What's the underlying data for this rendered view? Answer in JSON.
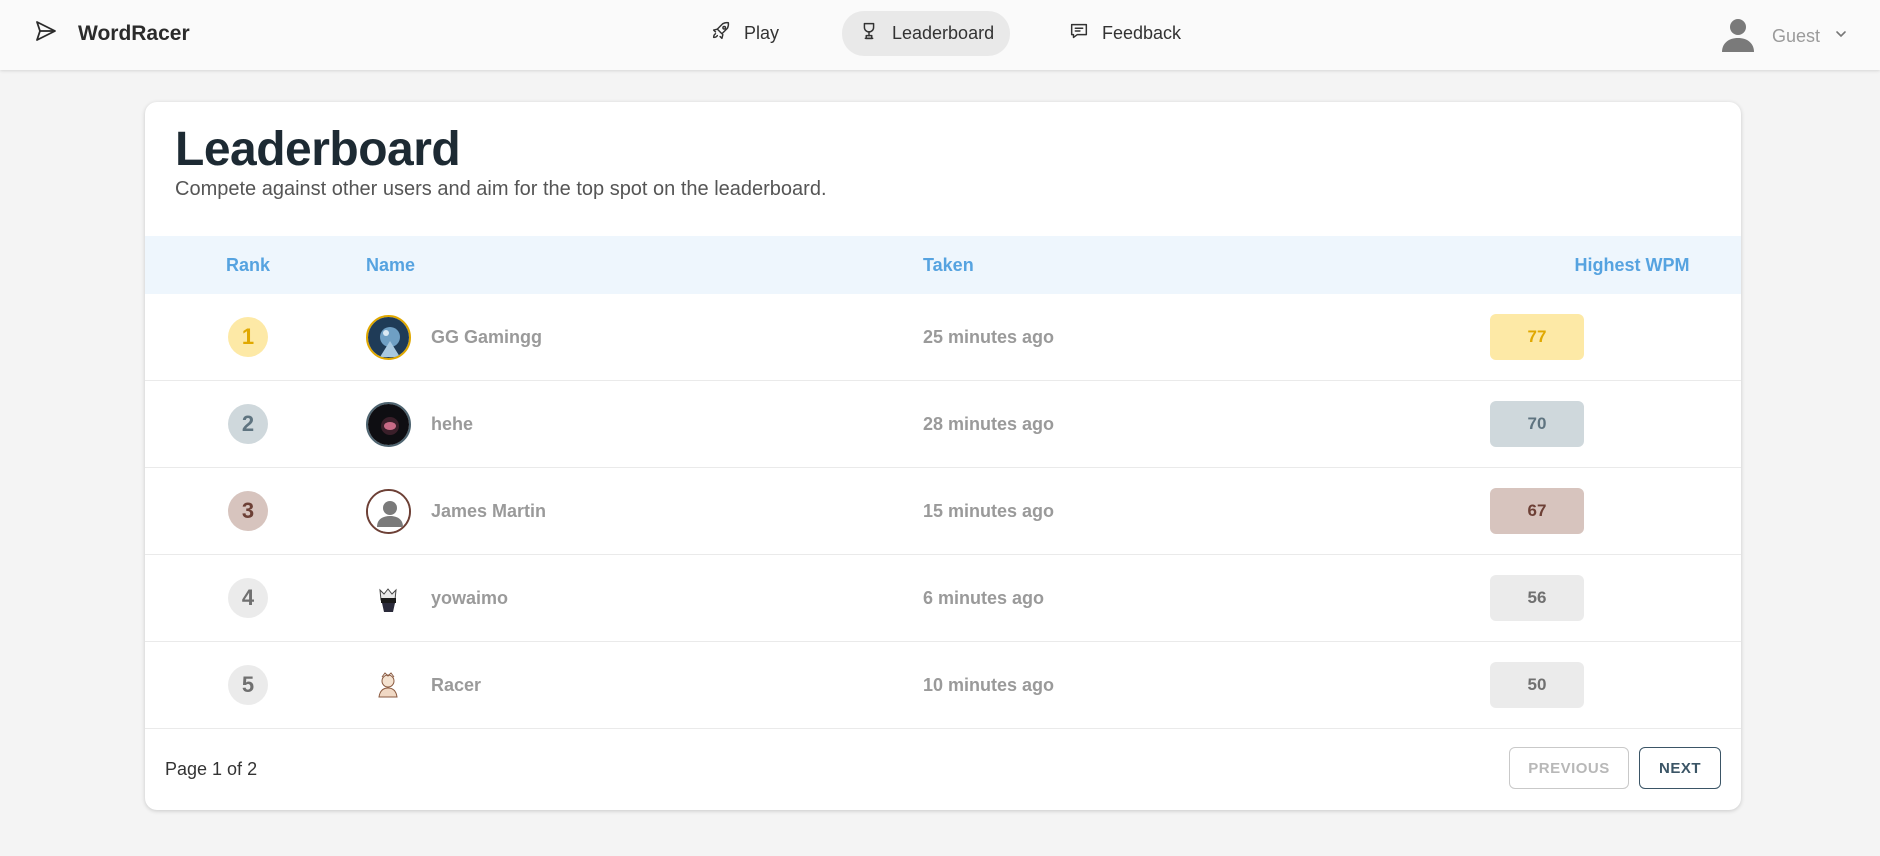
{
  "app": {
    "name": "WordRacer"
  },
  "nav": {
    "play": "Play",
    "leaderboard": "Leaderboard",
    "feedback": "Feedback"
  },
  "user": {
    "name": "Guest"
  },
  "page": {
    "title": "Leaderboard",
    "subtitle": "Compete against other users and aim for the top spot on the leaderboard."
  },
  "table": {
    "headers": {
      "rank": "Rank",
      "name": "Name",
      "taken": "Taken",
      "wpm": "Highest WPM"
    },
    "rows": [
      {
        "rank": "1",
        "name": "GG Gamingg",
        "taken": "25 minutes ago",
        "wpm": "77",
        "tier": "gold"
      },
      {
        "rank": "2",
        "name": "hehe",
        "taken": "28 minutes ago",
        "wpm": "70",
        "tier": "silver"
      },
      {
        "rank": "3",
        "name": "James Martin",
        "taken": "15 minutes ago",
        "wpm": "67",
        "tier": "bronze"
      },
      {
        "rank": "4",
        "name": "yowaimo",
        "taken": "6 minutes ago",
        "wpm": "56",
        "tier": "plain"
      },
      {
        "rank": "5",
        "name": "Racer",
        "taken": "10 minutes ago",
        "wpm": "50",
        "tier": "plain"
      }
    ]
  },
  "pagination": {
    "label": "Page 1 of 2",
    "previous": "PREVIOUS",
    "next": "NEXT"
  },
  "colors": {
    "accent": "#56a3e0",
    "gold_bg": "#fde9a6",
    "gold_fg": "#e0a800",
    "silver_bg": "#cfd8dc",
    "silver_fg": "#5f7480",
    "bronze_bg": "#d7c4be",
    "bronze_fg": "#6d4036",
    "plain_bg": "#ebebeb",
    "plain_fg": "#707070"
  }
}
